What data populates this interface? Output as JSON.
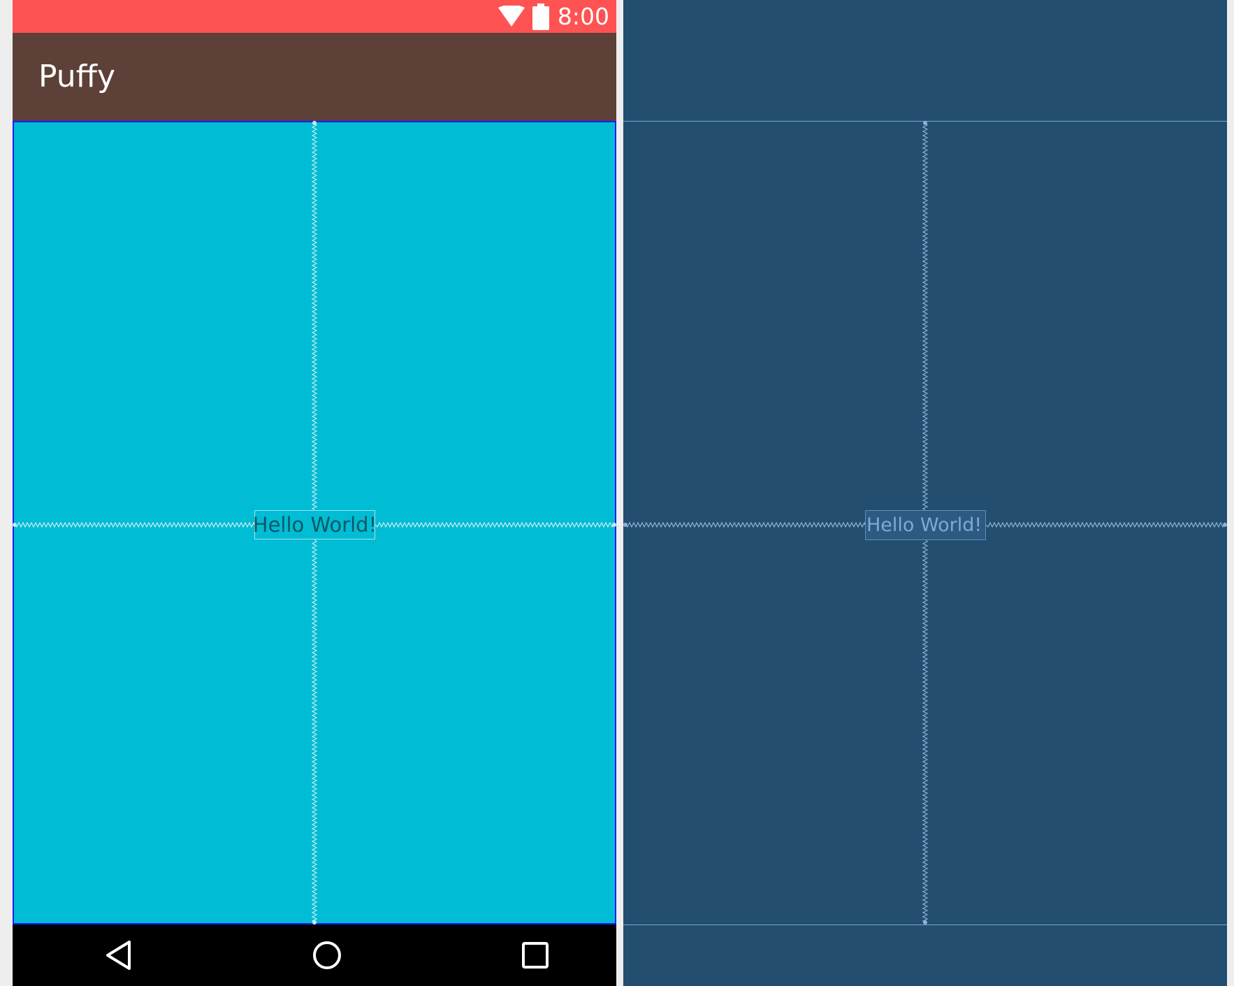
{
  "status_bar": {
    "time": "8:00",
    "wifi_icon": "wifi-icon",
    "battery_icon": "battery-icon",
    "color": "#ff5252"
  },
  "app_bar": {
    "title": "Puffy",
    "color": "#5d4037"
  },
  "content": {
    "background": "#00bcd4",
    "text": "Hello World!"
  },
  "blueprint": {
    "background": "#234e6f",
    "text": "Hello World!"
  },
  "nav_bar": {
    "buttons": [
      "back-icon",
      "home-icon",
      "recents-icon"
    ]
  }
}
